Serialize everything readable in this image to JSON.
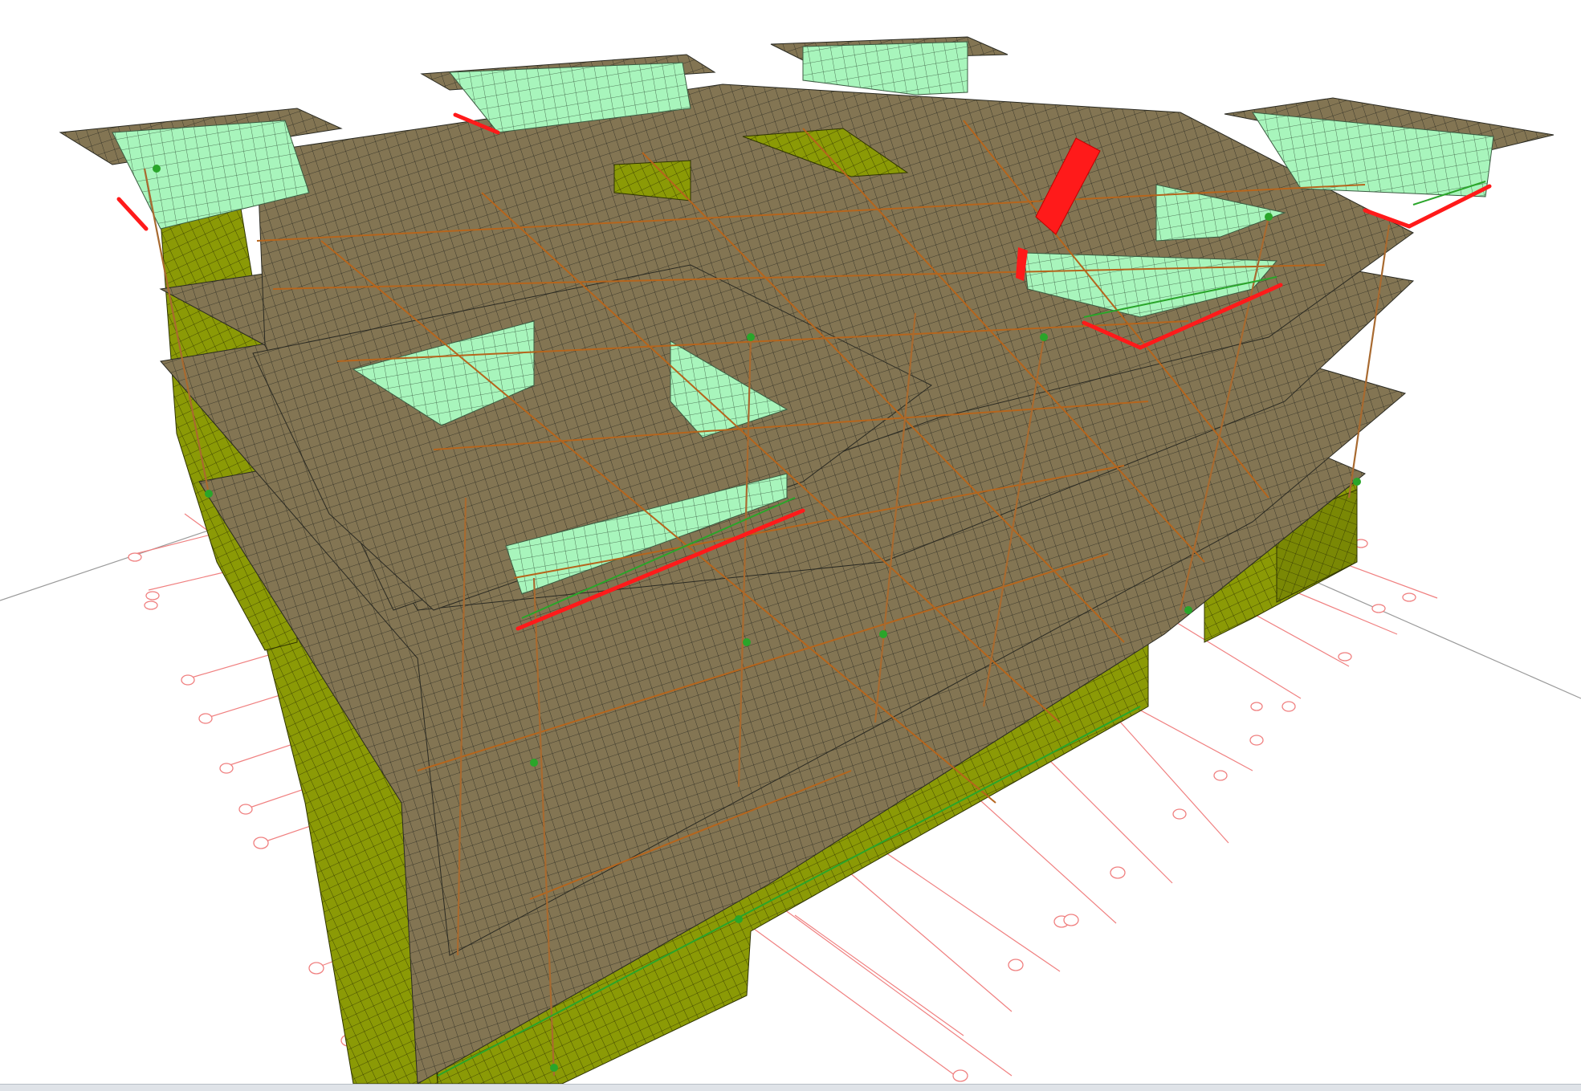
{
  "viewport": {
    "background": "#ffffff",
    "view_mode": "3D perspective"
  },
  "colors": {
    "slab": "#837553",
    "wall": "#8b9a06",
    "wall_dark": "#6e7c05",
    "opening_wall": "#a8f5bc",
    "mesh": "#2a2a22",
    "beam": "#b5651d",
    "grid_line": "#f08080",
    "highlight": "#ff1a1a",
    "support": "#2aa52a",
    "axis": "#9a9a9a",
    "status_strip": "#dfe3e8"
  },
  "icons": {
    "grid_bubble": "circle-grid-marker-icon",
    "support": "fixed-support-icon"
  }
}
